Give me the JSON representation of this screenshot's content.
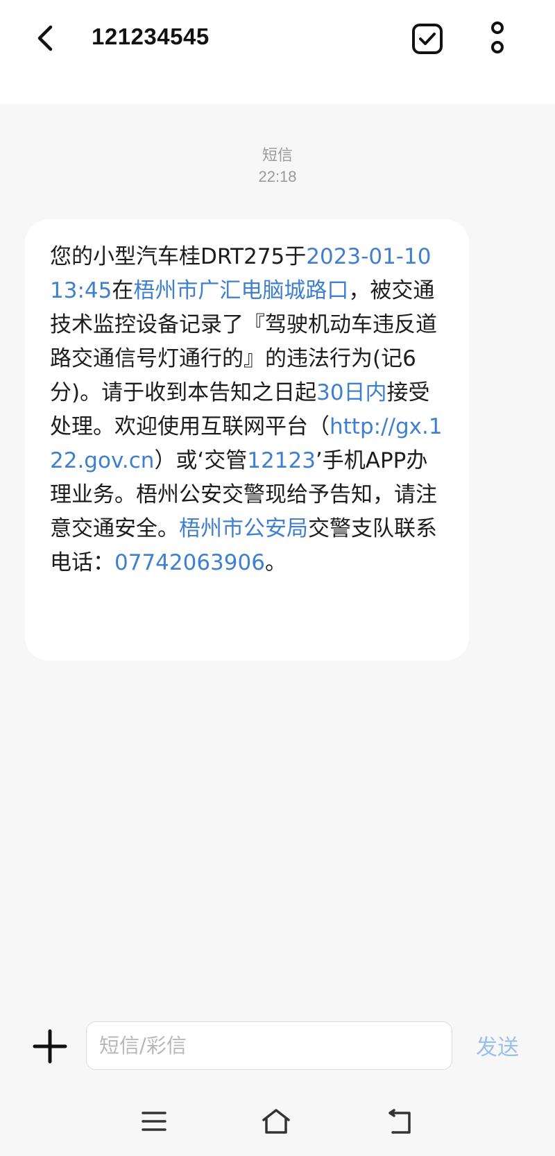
{
  "header": {
    "title": "121234545",
    "icons": {
      "back": "chevron-left-icon",
      "select": "checkbox-check-icon",
      "more": "vertical-dots-icon"
    }
  },
  "conversation": {
    "type_label": "短信",
    "time": "22:18"
  },
  "message": {
    "segments": [
      {
        "text": "您的小型汽车桂DRT275于",
        "link": false
      },
      {
        "text": "2023-01-10 13:45",
        "link": true
      },
      {
        "text": "在",
        "link": false
      },
      {
        "text": "梧州市广汇电脑城路口",
        "link": true
      },
      {
        "text": "，被交通技术监控设备记录了『驾驶机动车违反道路交通信号灯通行的』的违法行为(记6分)。请于收到本告知之日起",
        "link": false
      },
      {
        "text": "30日内",
        "link": true
      },
      {
        "text": "接受处理。欢迎使用互联网平台（",
        "link": false
      },
      {
        "text": "http://gx.122.gov.cn",
        "link": true
      },
      {
        "text": "）或‘交管",
        "link": false
      },
      {
        "text": "12123",
        "link": true
      },
      {
        "text": "’手机APP办理业务。梧州公安交警现给予告知，请注意交通安全。",
        "link": false
      },
      {
        "text": "梧州市公安局",
        "link": true
      },
      {
        "text": "交警支队联系电话：",
        "link": false
      },
      {
        "text": "07742063906",
        "link": true
      },
      {
        "text": "。",
        "link": false
      }
    ]
  },
  "composer": {
    "placeholder": "短信/彩信",
    "value": "",
    "send_label": "发送"
  },
  "colors": {
    "link": "#3f7fd0",
    "send_disabled": "#9cc0ea",
    "background": "#f7f7f7",
    "bubble": "#ffffff"
  },
  "navbar": {
    "icons": [
      "menu-icon",
      "home-icon",
      "back-icon"
    ]
  }
}
